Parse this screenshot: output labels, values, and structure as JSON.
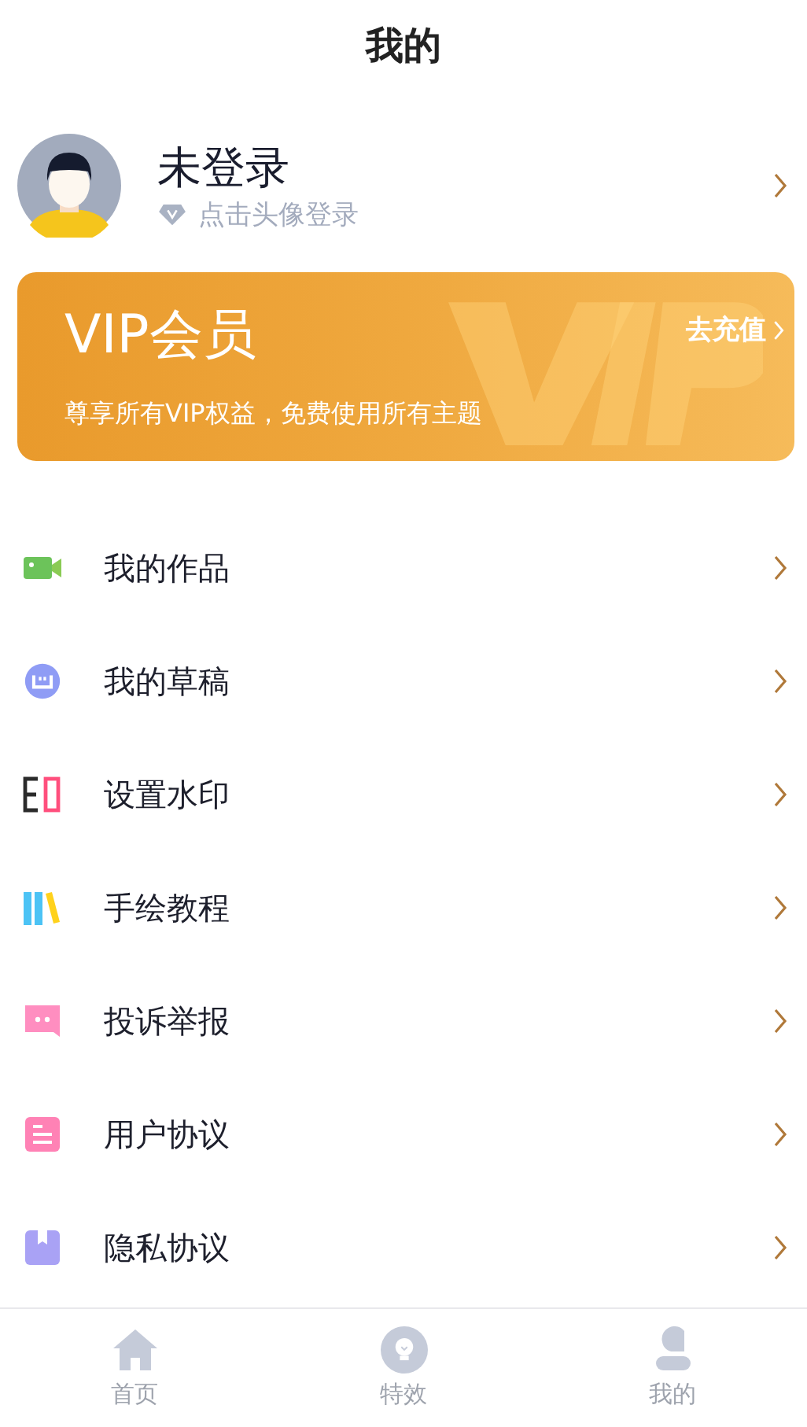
{
  "header": {
    "title": "我的"
  },
  "profile": {
    "name": "未登录",
    "hint": "点击头像登录"
  },
  "vip": {
    "title": "VIP会员",
    "subtitle": "尊享所有VIP权益，免费使用所有主题",
    "action": "去充值"
  },
  "menu": [
    {
      "label": "我的作品",
      "kind": "works"
    },
    {
      "label": "我的草稿",
      "kind": "drafts"
    },
    {
      "label": "设置水印",
      "kind": "watermark"
    },
    {
      "label": "手绘教程",
      "kind": "tutorial"
    },
    {
      "label": "投诉举报",
      "kind": "report"
    },
    {
      "label": "用户协议",
      "kind": "agreement"
    },
    {
      "label": "隐私协议",
      "kind": "privacy"
    }
  ],
  "tabbar": [
    {
      "label": "首页",
      "kind": "home",
      "selected": false
    },
    {
      "label": "特效",
      "kind": "effects",
      "selected": false
    },
    {
      "label": "我的",
      "kind": "mine",
      "selected": false
    }
  ]
}
